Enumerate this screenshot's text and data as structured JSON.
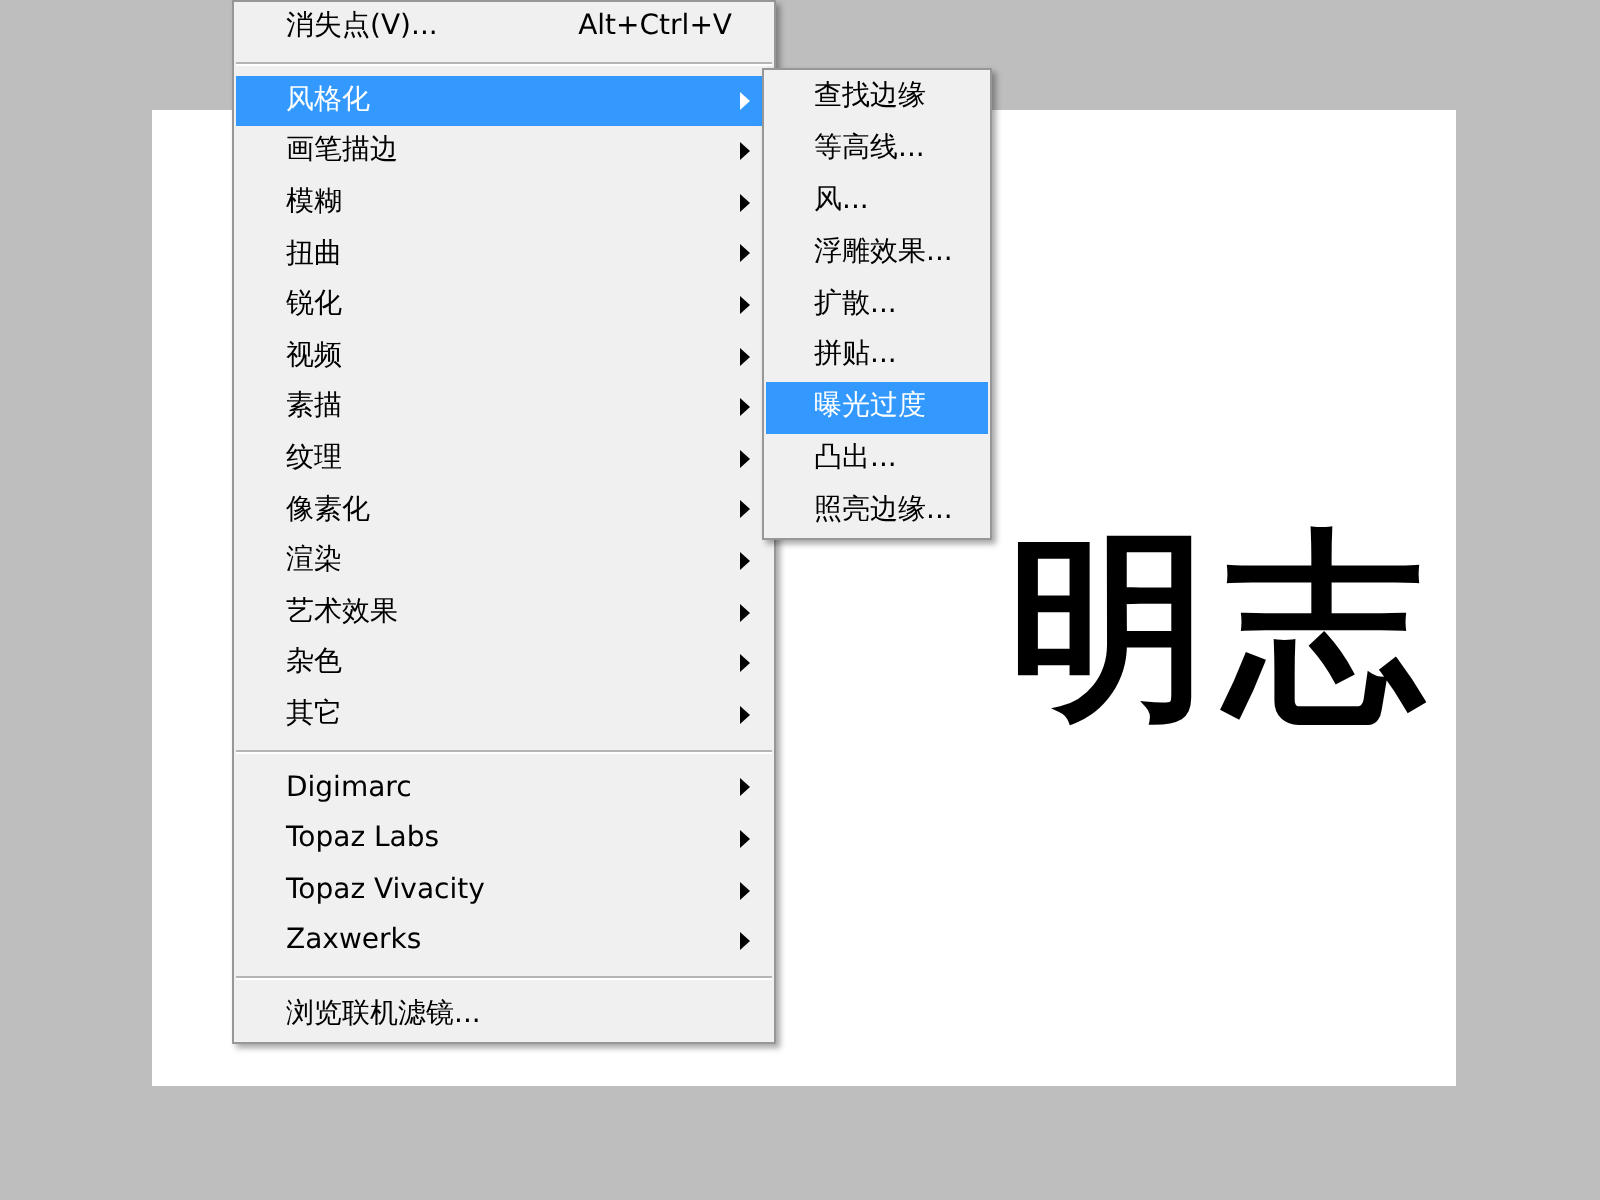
{
  "canvas_text": "明志",
  "menu": {
    "items": [
      {
        "kind": "item",
        "label": "消失点(V)...",
        "shortcut": "Alt+Ctrl+V",
        "has_submenu": false,
        "selected": false
      },
      {
        "kind": "separator"
      },
      {
        "kind": "item",
        "label": "风格化",
        "has_submenu": true,
        "selected": true
      },
      {
        "kind": "item",
        "label": "画笔描边",
        "has_submenu": true,
        "selected": false
      },
      {
        "kind": "item",
        "label": "模糊",
        "has_submenu": true,
        "selected": false
      },
      {
        "kind": "item",
        "label": "扭曲",
        "has_submenu": true,
        "selected": false
      },
      {
        "kind": "item",
        "label": "锐化",
        "has_submenu": true,
        "selected": false
      },
      {
        "kind": "item",
        "label": "视频",
        "has_submenu": true,
        "selected": false
      },
      {
        "kind": "item",
        "label": "素描",
        "has_submenu": true,
        "selected": false
      },
      {
        "kind": "item",
        "label": "纹理",
        "has_submenu": true,
        "selected": false
      },
      {
        "kind": "item",
        "label": "像素化",
        "has_submenu": true,
        "selected": false
      },
      {
        "kind": "item",
        "label": "渲染",
        "has_submenu": true,
        "selected": false
      },
      {
        "kind": "item",
        "label": "艺术效果",
        "has_submenu": true,
        "selected": false
      },
      {
        "kind": "item",
        "label": "杂色",
        "has_submenu": true,
        "selected": false
      },
      {
        "kind": "item",
        "label": "其它",
        "has_submenu": true,
        "selected": false
      },
      {
        "kind": "separator"
      },
      {
        "kind": "item",
        "label": "Digimarc",
        "has_submenu": true,
        "selected": false
      },
      {
        "kind": "item",
        "label": "Topaz Labs",
        "has_submenu": true,
        "selected": false
      },
      {
        "kind": "item",
        "label": "Topaz Vivacity",
        "has_submenu": true,
        "selected": false
      },
      {
        "kind": "item",
        "label": "Zaxwerks",
        "has_submenu": true,
        "selected": false
      },
      {
        "kind": "separator"
      },
      {
        "kind": "item",
        "label": "浏览联机滤镜...",
        "has_submenu": false,
        "selected": false
      }
    ]
  },
  "submenu": {
    "items": [
      {
        "label": "查找边缘",
        "selected": false
      },
      {
        "label": "等高线...",
        "selected": false
      },
      {
        "label": "风...",
        "selected": false
      },
      {
        "label": "浮雕效果...",
        "selected": false
      },
      {
        "label": "扩散...",
        "selected": false
      },
      {
        "label": "拼贴...",
        "selected": false
      },
      {
        "label": "曝光过度",
        "selected": true
      },
      {
        "label": "凸出...",
        "selected": false
      },
      {
        "label": "照亮边缘...",
        "selected": false
      }
    ]
  }
}
